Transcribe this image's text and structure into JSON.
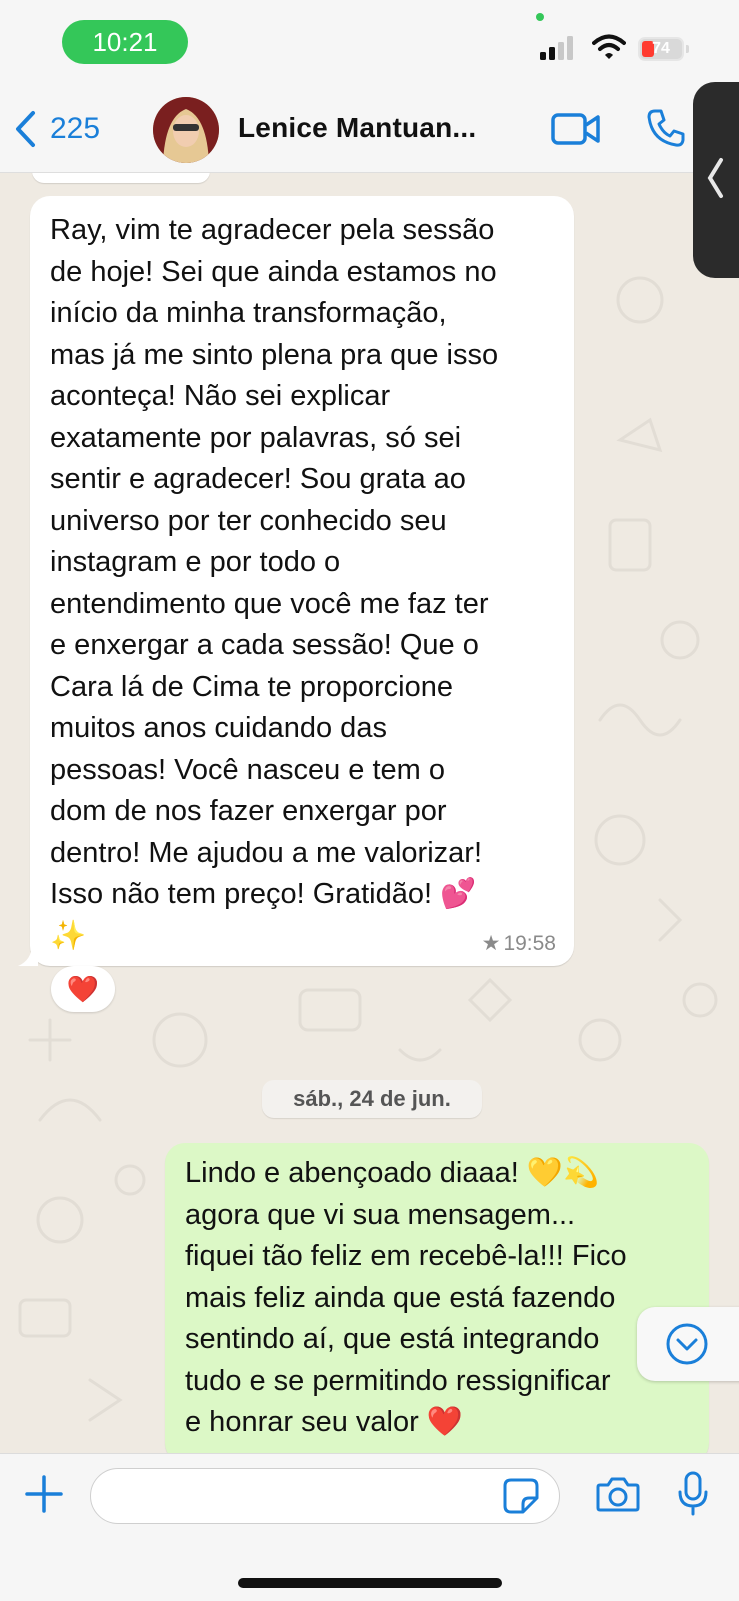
{
  "status_bar": {
    "time": "10:21",
    "battery_level": "74",
    "accent_green": "#34c759"
  },
  "header": {
    "back_count": "225",
    "contact_name": "Lenice Mantuan...",
    "icons": [
      "chevron-left-icon",
      "video-camera-icon",
      "phone-icon"
    ],
    "accent_blue": "#1a7fd9"
  },
  "messages": [
    {
      "direction": "incoming",
      "text": "Ray, vim te agradecer pela sessão\nde hoje! Sei que ainda estamos no\ninício da minha transformação,\nmas já me sinto plena pra que isso\naconteça! Não sei explicar\nexatamente por palavras, só sei\nsentir e agradecer! Sou grata ao\nuniverso por ter conhecido seu\ninstagram e por todo o\nentendimento que você me faz ter\ne enxergar a cada sessão! Que o\nCara lá de Cima te proporcione\nmuitos anos cuidando das\npessoas! Você nasceu e tem o\ndom de nos fazer enxergar por\ndentro! Me ajudou a me valorizar!\nIsso não tem preço! Gratidão! 💕\n✨",
      "time": "19:58",
      "starred": true,
      "reaction": "❤️"
    },
    {
      "direction": "outgoing",
      "text": "Lindo e abençoado diaaa! 💛💫\nagora que vi sua mensagem...\nfiquei tão feliz em recebê-la!!! Fico\nmais feliz ainda que está fazendo\nsentindo aí, que está integrando\ntudo e se permitindo ressignificar\ne honrar seu valor ❤️"
    }
  ],
  "date_separator": "sáb., 24 de jun.",
  "input_bar": {
    "placeholder": "",
    "icons": [
      "plus-icon",
      "sticker-icon",
      "camera-icon",
      "microphone-icon"
    ]
  },
  "colors": {
    "background": "#efeae2",
    "incoming_bubble": "#ffffff",
    "outgoing_bubble": "#dcf8c6"
  }
}
